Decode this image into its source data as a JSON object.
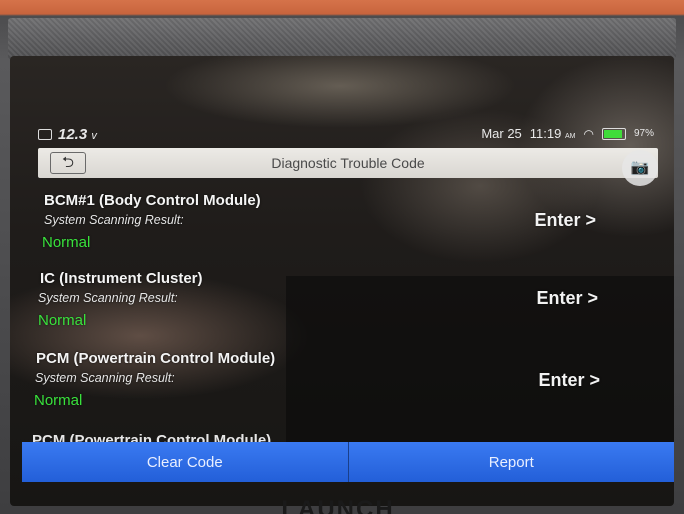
{
  "status_bar": {
    "voltage": "12.3",
    "voltage_unit": "v",
    "date": "Mar 25",
    "time": "11:19",
    "ampm": "AM",
    "battery_percent": "97%"
  },
  "header": {
    "back_icon": "back-arrow-icon",
    "title": "Diagnostic Trouble Code",
    "camera_icon": "camera-icon"
  },
  "modules": [
    {
      "name": "BCM#1 (Body Control Module)",
      "scan_label": "System Scanning Result:",
      "result": "Normal",
      "enter_label": "Enter >"
    },
    {
      "name": "IC (Instrument Cluster)",
      "scan_label": "System Scanning Result:",
      "result": "Normal",
      "enter_label": "Enter >"
    },
    {
      "name": "PCM (Powertrain Control Module)",
      "scan_label": "System Scanning Result:",
      "result": "Normal",
      "enter_label": "Enter >"
    },
    {
      "name": "PCM (Powertrain Control Module)"
    }
  ],
  "bottom_bar": {
    "clear_code_label": "Clear Code",
    "report_label": "Report"
  },
  "brand": "LAUNCH",
  "colors": {
    "accent_blue": "#2f6fe8",
    "normal_green": "#39e23c",
    "device_orange": "#c9683f"
  }
}
